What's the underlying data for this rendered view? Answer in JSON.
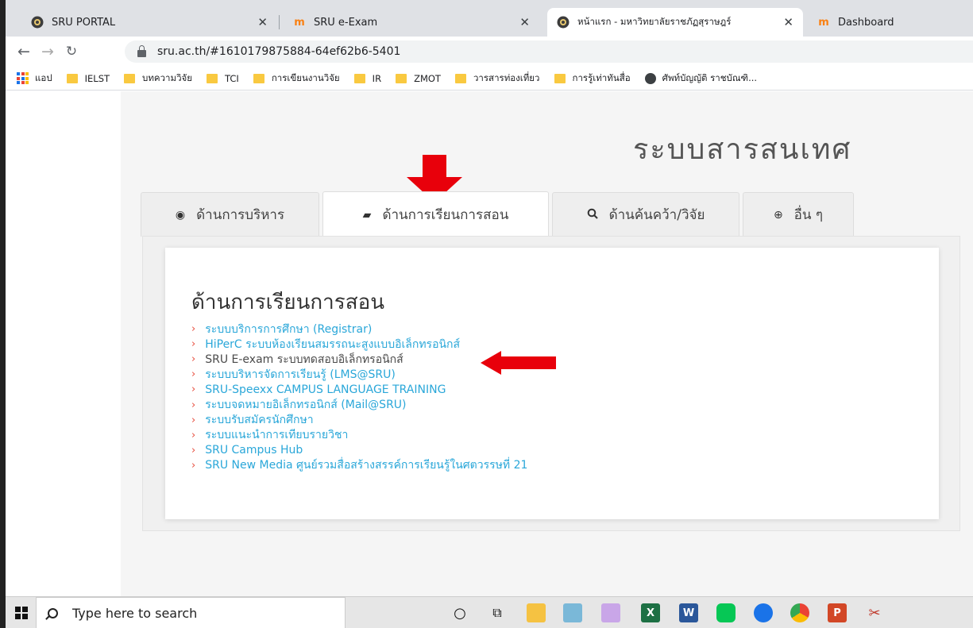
{
  "browser": {
    "tabs": [
      {
        "title": "SRU PORTAL",
        "favicon": "sru-logo-icon",
        "active": false
      },
      {
        "title": "SRU e-Exam",
        "favicon": "moodle-icon",
        "active": false
      },
      {
        "title": "หน้าแรก - มหาวิทยาลัยราชภัฏสุราษฎร์",
        "favicon": "sru-logo-icon",
        "active": true
      },
      {
        "title": "Dashboard",
        "favicon": "moodle-icon",
        "active": false
      }
    ],
    "url": "sru.ac.th/#1610179875884-64ef62b6-5401",
    "bookmarks": [
      {
        "label": "แอป",
        "icon": "apps-grid-icon"
      },
      {
        "label": "IELST",
        "icon": "folder-icon"
      },
      {
        "label": "บทความวิจัย",
        "icon": "folder-icon"
      },
      {
        "label": "TCI",
        "icon": "folder-icon"
      },
      {
        "label": "การเขียนงานวิจัย",
        "icon": "folder-icon"
      },
      {
        "label": "IR",
        "icon": "folder-icon"
      },
      {
        "label": "ZMOT",
        "icon": "folder-icon"
      },
      {
        "label": "วารสารท่องเที่ยว",
        "icon": "folder-icon"
      },
      {
        "label": "การรู้เท่าทันสื่อ",
        "icon": "folder-icon"
      },
      {
        "label": "ศัพท์บัญญัติ ราชบัณฑิ...",
        "icon": "globe-icon"
      }
    ]
  },
  "page": {
    "site_title": "ระบบสารสนเทศ",
    "nav_tabs": [
      {
        "label": "ด้านการบริหาร",
        "icon": "user-circle-icon",
        "active": false
      },
      {
        "label": "ด้านการเรียนการสอน",
        "icon": "book-icon",
        "active": true
      },
      {
        "label": "ด้านค้นคว้า/วิจัย",
        "icon": "search-icon",
        "active": false
      },
      {
        "label": "อื่น ๆ",
        "icon": "plus-circle-icon",
        "active": false
      }
    ],
    "panel": {
      "heading": "ด้านการเรียนการสอน",
      "links": [
        "ระบบบริการการศึกษา (Registrar)",
        "HiPerC ระบบห้องเรียนสมรรถนะสูงแบบอิเล็กทรอนิกส์",
        "SRU E-exam ระบบทดสอบอิเล็กทรอนิกส์",
        "ระบบบริหารจัดการเรียนรู้ (LMS@SRU)",
        "SRU-Speexx CAMPUS LANGUAGE TRAINING",
        "ระบบจดหมายอิเล็กทรอนิกส์ (Mail@SRU)",
        "ระบบรับสมัครนักศึกษา",
        "ระบบแนะนำการเทียบรายวิชา",
        "SRU Campus Hub",
        "SRU New Media ศูนย์รวมสื่อสร้างสรรค์การเรียนรู้ในศตวรรษที่ 21"
      ]
    }
  },
  "taskbar": {
    "search_placeholder": "Type here to search"
  },
  "colors": {
    "link": "#2aa7d9",
    "chevron": "#e74c3c",
    "annotation_arrow": "#e8000b"
  }
}
